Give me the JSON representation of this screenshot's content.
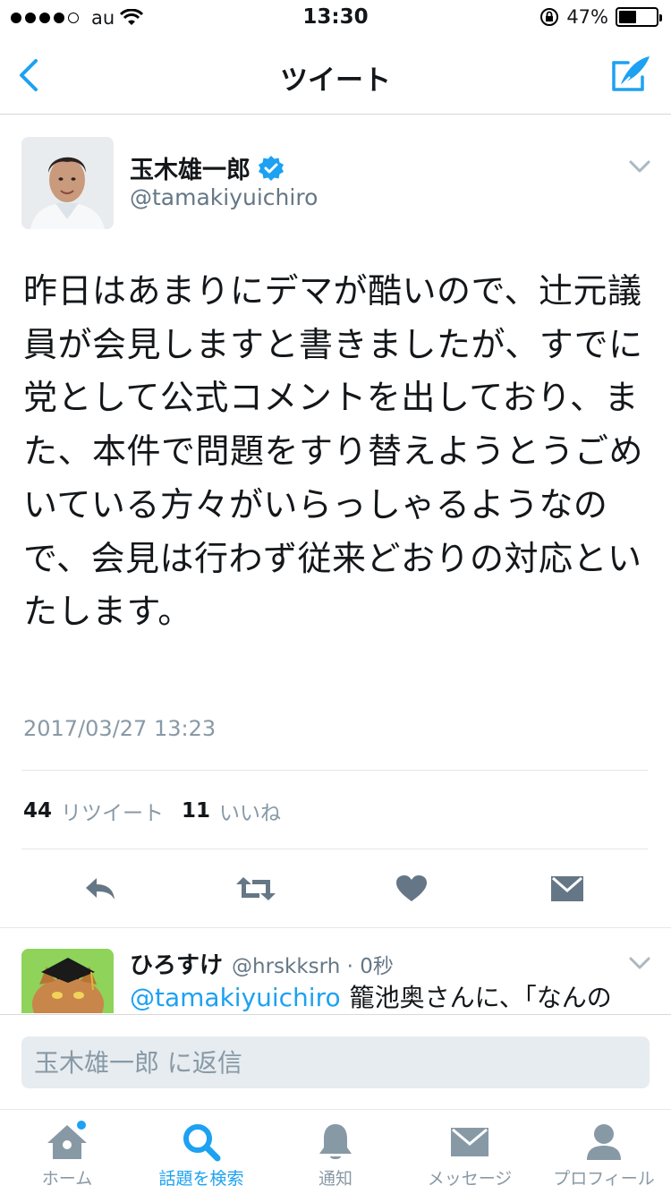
{
  "status_bar": {
    "carrier": "au",
    "time": "13:30",
    "battery": "47%",
    "battery_level": 0.47
  },
  "nav": {
    "title": "ツイート",
    "back_icon": "chevron-left-icon",
    "compose_icon": "compose-quill-icon"
  },
  "tweet": {
    "author_name": "玉木雄一郎",
    "author_handle": "@tamakiyuichiro",
    "verified": true,
    "text": "昨日はあまりにデマが酷いので、辻元議員が会見しますと書きましたが、すでに党として公式コメントを出しており、また、本件で問題をすり替えようとうごめいている方々がいらっしゃるようなので、会見は行わず従来どおりの対応といたします。",
    "timestamp": "2017/03/27 13:23",
    "retweet_count": "44",
    "retweet_label": "リツイート",
    "like_count": "11",
    "like_label": "いいね"
  },
  "actions": [
    "reply-icon",
    "retweet-icon",
    "like-heart-icon",
    "direct-message-icon"
  ],
  "reply_tweet": {
    "author_name": "ひろすけ",
    "author_meta": "@hrskksrh · 0秒",
    "mention": "@tamakiyuichiro",
    "text": "籠池奥さんに、「なんの"
  },
  "reply_box": {
    "placeholder": "玉木雄一郎 に返信"
  },
  "tabs": [
    {
      "label": "ホーム",
      "icon": "home-icon",
      "active": false
    },
    {
      "label": "話題を検索",
      "icon": "search-icon",
      "active": true
    },
    {
      "label": "通知",
      "icon": "bell-icon",
      "active": false
    },
    {
      "label": "メッセージ",
      "icon": "envelope-icon",
      "active": false
    },
    {
      "label": "プロフィール",
      "icon": "person-icon",
      "active": false
    }
  ],
  "colors": {
    "accent": "#1da1f2",
    "muted": "#8899a6",
    "text": "#14171a"
  }
}
